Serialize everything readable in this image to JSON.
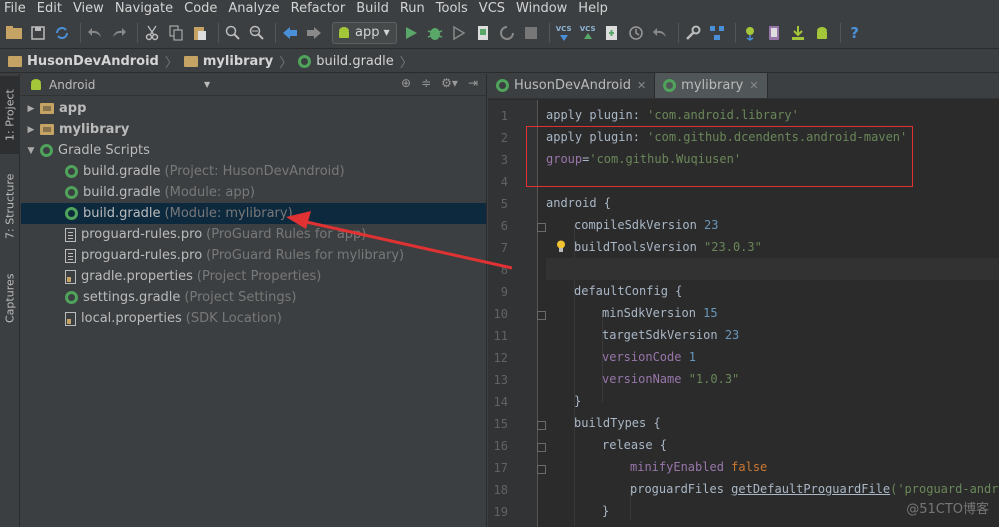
{
  "menu": [
    "File",
    "Edit",
    "View",
    "Navigate",
    "Code",
    "Analyze",
    "Refactor",
    "Build",
    "Run",
    "Tools",
    "VCS",
    "Window",
    "Help"
  ],
  "toolbar": {
    "run_config": "app",
    "vcs_label": "VCS"
  },
  "breadcrumb": [
    "HusonDevAndroid",
    "mylibrary",
    "build.gradle"
  ],
  "side_tabs": [
    "1: Project",
    "7: Structure",
    "Captures"
  ],
  "project": {
    "view": "Android",
    "tree": [
      {
        "name": "app",
        "hint": "",
        "bold": true,
        "arrow": "▶"
      },
      {
        "name": "mylibrary",
        "hint": "",
        "bold": true,
        "arrow": "▶"
      },
      {
        "name": "Gradle Scripts",
        "hint": "",
        "bold": false,
        "arrow": "▼"
      },
      {
        "name": "build.gradle",
        "hint": "(Project: HusonDevAndroid)"
      },
      {
        "name": "build.gradle",
        "hint": "(Module: app)"
      },
      {
        "name": "build.gradle",
        "hint": "(Module: mylibrary)"
      },
      {
        "name": "proguard-rules.pro",
        "hint": "(ProGuard Rules for app)"
      },
      {
        "name": "proguard-rules.pro",
        "hint": "(ProGuard Rules for mylibrary)"
      },
      {
        "name": "gradle.properties",
        "hint": "(Project Properties)"
      },
      {
        "name": "settings.gradle",
        "hint": "(Project Settings)"
      },
      {
        "name": "local.properties",
        "hint": "(SDK Location)"
      }
    ]
  },
  "editor": {
    "tabs": [
      "HusonDevAndroid",
      "mylibrary"
    ],
    "line_numbers": [
      "1",
      "2",
      "3",
      "4",
      "5",
      "6",
      "7",
      "8",
      "9",
      "10",
      "11",
      "12",
      "13",
      "14",
      "15",
      "16",
      "17",
      "18",
      "19"
    ],
    "code": {
      "l1_kw": "apply plugin: ",
      "l1_str": "'com.android.library'",
      "l2_kw": "apply plugin: ",
      "l2_str": "'com.github.dcendents.android-maven'",
      "l3_prop": "group",
      "l3_eq": "=",
      "l3_str": "'com.github.Wuqiusen'",
      "l5": "android {",
      "l6_kw": "compileSdkVersion ",
      "l6_num": "23",
      "l7_kw": "buildToolsVersion ",
      "l7_str": "\"23.0.3\"",
      "l9": "defaultConfig {",
      "l10_kw": "minSdkVersion ",
      "l10_num": "15",
      "l11_kw": "targetSdkVersion ",
      "l11_num": "23",
      "l12_prop": "versionCode ",
      "l12_num": "1",
      "l13_prop": "versionName ",
      "l13_str": "\"1.0.3\"",
      "l14": "}",
      "l15": "buildTypes {",
      "l16": "release {",
      "l17_prop": "minifyEnabled ",
      "l17_kw": "false",
      "l18_kw": "proguardFiles ",
      "l18_fn": "getDefaultProguardFile",
      "l18_str": "('proguard-android",
      "l19": "}"
    }
  },
  "watermark": "@51CTO博客",
  "colors": {
    "annotation": "#e03232",
    "selection": "#0d293e"
  }
}
